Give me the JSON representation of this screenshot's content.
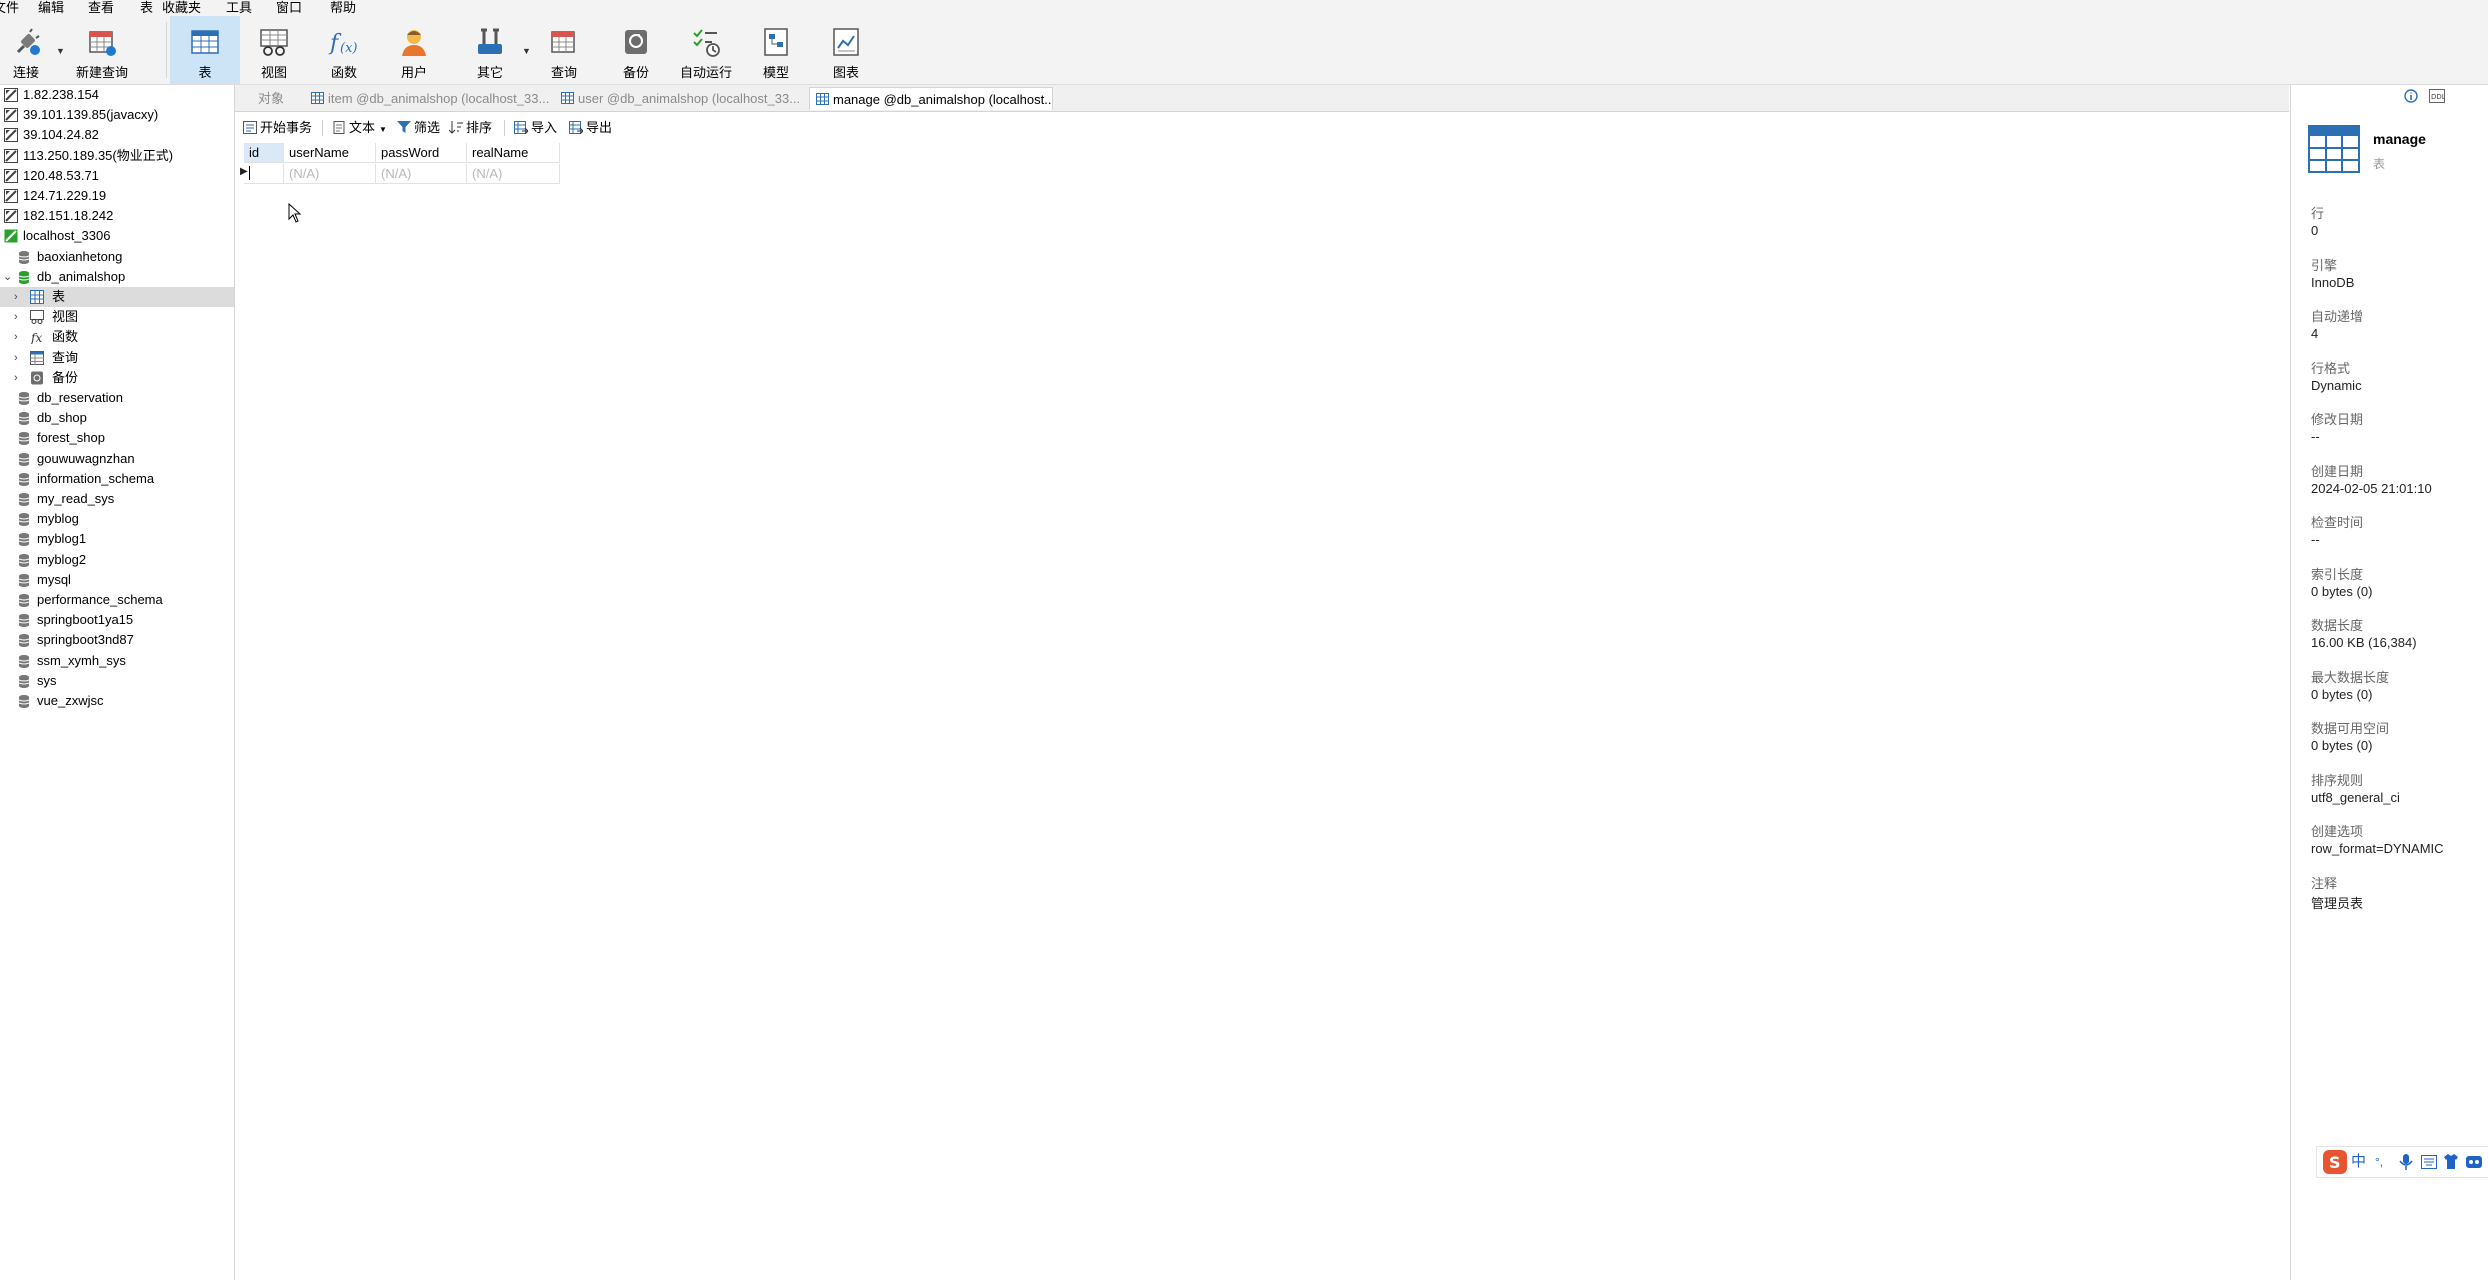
{
  "menubar": [
    "文件",
    "编辑",
    "查看",
    "表",
    "收藏夹",
    "工具",
    "窗口",
    "帮助"
  ],
  "toolbar": {
    "connect": "连接",
    "new_query": "新建查询",
    "table": "表",
    "view": "视图",
    "function": "函数",
    "user": "用户",
    "other": "其它",
    "query": "查询",
    "backup": "备份",
    "autorun": "自动运行",
    "model": "模型",
    "chart": "图表"
  },
  "tree": {
    "connections": [
      "1.82.238.154",
      "39.101.139.85(javacxy)",
      "39.104.24.82",
      "113.250.189.35(物业正式)",
      "120.48.53.71",
      "124.71.229.19",
      "182.151.18.242",
      "localhost_3306"
    ],
    "db_before": "baoxianhetong",
    "open_db": "db_animalshop",
    "children": [
      "表",
      "视图",
      "函数",
      "查询",
      "备份"
    ],
    "databases_after": [
      "db_reservation",
      "db_shop",
      "forest_shop",
      "gouwuwagnzhan",
      "information_schema",
      "my_read_sys",
      "myblog",
      "myblog1",
      "myblog2",
      "mysql",
      "performance_schema",
      "springboot1ya15",
      "springboot3nd87",
      "ssm_xymh_sys",
      "sys",
      "vue_zxwjsc"
    ]
  },
  "tabs": [
    "对象",
    "item @db_animalshop (localhost_33...",
    "user @db_animalshop (localhost_33...",
    "manage @db_animalshop (localhost..."
  ],
  "subtoolbar": {
    "begin_tx": "开始事务",
    "text": "文本",
    "filter": "筛选",
    "sort": "排序",
    "import": "导入",
    "export": "导出"
  },
  "grid": {
    "columns": [
      "id",
      "userName",
      "passWord",
      "realName"
    ],
    "null_text": "(N/A)"
  },
  "panel": {
    "name": "manage",
    "type": "表",
    "props": [
      {
        "label": "行",
        "value": "0"
      },
      {
        "label": "引擎",
        "value": "InnoDB"
      },
      {
        "label": "自动递增",
        "value": "4"
      },
      {
        "label": "行格式",
        "value": "Dynamic"
      },
      {
        "label": "修改日期",
        "value": "--"
      },
      {
        "label": "创建日期",
        "value": "2024-02-05 21:01:10"
      },
      {
        "label": "检查时间",
        "value": "--"
      },
      {
        "label": "索引长度",
        "value": "0 bytes (0)"
      },
      {
        "label": "数据长度",
        "value": "16.00 KB (16,384)"
      },
      {
        "label": "最大数据长度",
        "value": "0 bytes (0)"
      },
      {
        "label": "数据可用空间",
        "value": "0 bytes (0)"
      },
      {
        "label": "排序规则",
        "value": "utf8_general_ci"
      },
      {
        "label": "创建选项",
        "value": "row_format=DYNAMIC"
      },
      {
        "label": "注释",
        "value": "管理员表"
      }
    ]
  },
  "ime": {
    "lang": "中",
    "punct": "°,"
  },
  "colors": {
    "accent": "#1f7ad0",
    "selected_tool": "#cde4f7",
    "tree_selected": "#dcdcdc",
    "db_green": "#2ca02c"
  }
}
